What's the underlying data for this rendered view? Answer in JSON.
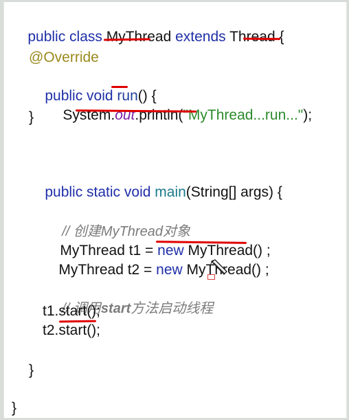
{
  "code": {
    "class_decl": {
      "kw_public_class": "public class ",
      "class_name": "MyThread",
      "kw_extends": " extends ",
      "super_name": "Thread",
      "brace": " {"
    },
    "annotation": "@Override",
    "run_decl": {
      "kw_public_void": "public void ",
      "method_name": "run",
      "rest": "() {"
    },
    "println_line": {
      "system": "System.",
      "out": "out",
      "println": ".println(",
      "string": "\"MyThread...run...\"",
      "end": ");"
    },
    "run_close": "}",
    "main_decl": {
      "kw_public_static_void": "public static void ",
      "method_name": "main",
      "rest": "(String[] args) {"
    },
    "comment_create": {
      "prefix": "// 创建",
      "bold": "MyThread",
      "suffix": "对象"
    },
    "t1_line": {
      "decl": "MyThread t1 = ",
      "kw_new": "new",
      "rest": " MyThread() ;"
    },
    "t2_line": {
      "decl": "MyThread t2 = ",
      "kw_new": "new",
      "rest": " MyThread() ;"
    },
    "comment_start": {
      "prefix": "// 调用",
      "bold": "start",
      "suffix": "方法启动线程"
    },
    "t1_start": "t1.start();",
    "t2_start": "t2.start();",
    "main_close": "}",
    "class_close": "}"
  },
  "colors": {
    "keyword": "#1f2fa8",
    "annotation": "#9a8a1e",
    "string": "#2a8a2a",
    "static_field": "#7b1fa2",
    "comment": "#7b7b7b",
    "underline": "#e00000"
  },
  "icons": {
    "cursor": "pen-cursor-icon"
  }
}
